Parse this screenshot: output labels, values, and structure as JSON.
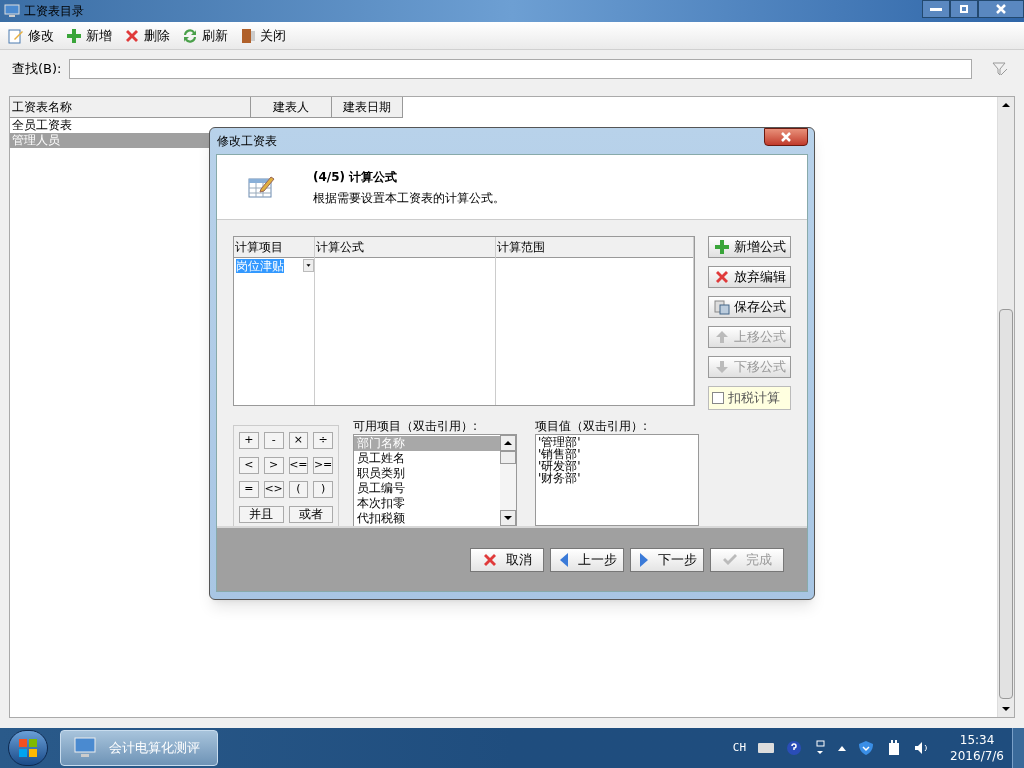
{
  "window": {
    "title": "工资表目录"
  },
  "toolbar": [
    {
      "label": "修改"
    },
    {
      "label": "新增"
    },
    {
      "label": "删除"
    },
    {
      "label": "刷新"
    },
    {
      "label": "关闭"
    }
  ],
  "search": {
    "label": "查找(B):"
  },
  "table": {
    "columns": [
      "工资表名称",
      "建表人",
      "建表日期"
    ],
    "rows": [
      {
        "name": "全员工资表",
        "selected": false
      },
      {
        "name": "管理人员",
        "selected": true
      }
    ]
  },
  "dialog": {
    "title": "修改工资表",
    "step": "(4/5) 计算公式",
    "description": "根据需要设置本工资表的计算公式。",
    "grid": {
      "columns": [
        "计算项目",
        "计算公式",
        "计算范围"
      ],
      "rows": [
        {
          "item": "岗位津贴",
          "selected": true
        }
      ]
    },
    "side_buttons": [
      {
        "label": "新增公式",
        "disabled": false
      },
      {
        "label": "放弃编辑",
        "disabled": false
      },
      {
        "label": "保存公式",
        "disabled": false
      },
      {
        "label": "上移公式",
        "disabled": true
      },
      {
        "label": "下移公式",
        "disabled": true
      }
    ],
    "tax_checkbox": {
      "label": "扣税计算",
      "checked": false
    },
    "operators": [
      "+",
      "-",
      "×",
      "÷",
      "<",
      ">",
      "<=",
      ">=",
      "=",
      "<>",
      "(",
      ")",
      "并且",
      "或者"
    ],
    "available": {
      "label": "可用项目（双击引用）:",
      "items": [
        {
          "text": "部门名称",
          "selected": true
        },
        {
          "text": "员工姓名",
          "selected": false
        },
        {
          "text": "职员类别",
          "selected": false
        },
        {
          "text": "员工编号",
          "selected": false
        },
        {
          "text": "本次扣零",
          "selected": false
        },
        {
          "text": "代扣税额",
          "selected": false
        }
      ]
    },
    "values": {
      "label": "项目值（双击引用）:",
      "items": [
        "'管理部'",
        "'销售部'",
        "'研发部'",
        "'财务部'"
      ]
    },
    "footer_buttons": [
      {
        "label": "取消",
        "disabled": false
      },
      {
        "label": "上一步",
        "disabled": false
      },
      {
        "label": "下一步",
        "disabled": false
      },
      {
        "label": "完成",
        "disabled": true
      }
    ]
  },
  "taskbar": {
    "app": "会计电算化测评",
    "language": "CH",
    "time": "15:34",
    "date": "2016/7/6"
  }
}
